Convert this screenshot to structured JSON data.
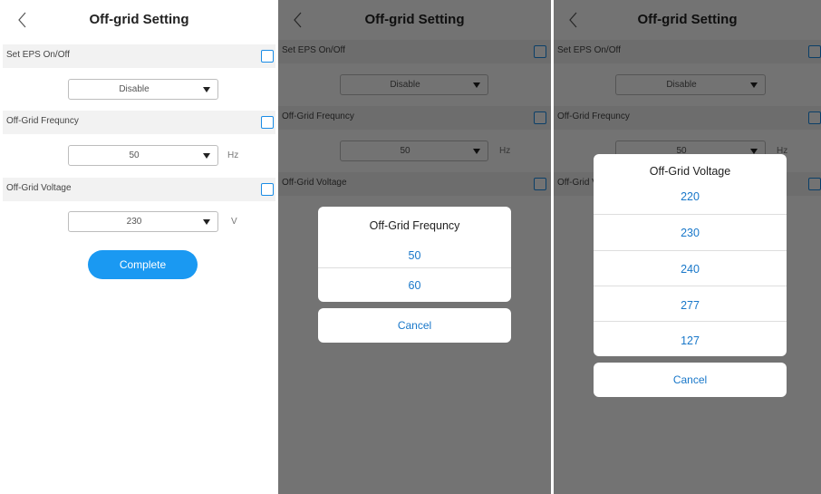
{
  "screen": {
    "title": "Off-grid Setting",
    "eps_label": "Set EPS On/Off",
    "eps_value": "Disable",
    "freq_label": "Off-Grid Frequncy",
    "freq_value": "50",
    "freq_unit": "Hz",
    "volt_label": "Off-Grid Voltage",
    "volt_value": "230",
    "volt_unit": "V",
    "complete_label": "Complete",
    "icons": {
      "back": "chevron-left-icon",
      "checkbox": "checkbox-icon",
      "dropdown": "caret-down-icon"
    }
  },
  "freq_picker": {
    "title": "Off-Grid Frequncy",
    "options": [
      "50",
      "60"
    ],
    "cancel": "Cancel"
  },
  "volt_picker": {
    "title": "Off-Grid Voltage",
    "options": [
      "220",
      "230",
      "240",
      "277",
      "127"
    ],
    "cancel": "Cancel"
  },
  "colors": {
    "accent": "#1a99f2",
    "option_text": "#1877c9",
    "checkbox": "#1a8ce6",
    "row_bg": "#f2f2f2"
  }
}
